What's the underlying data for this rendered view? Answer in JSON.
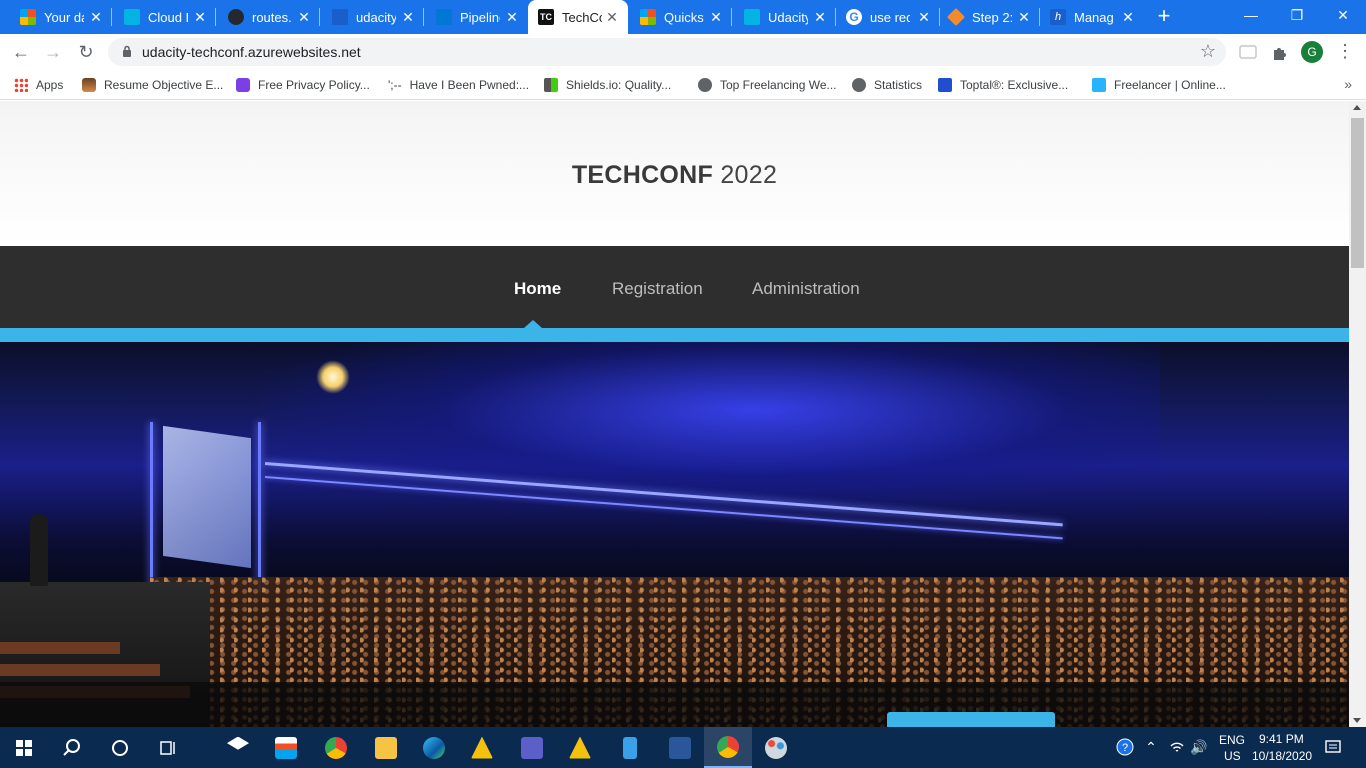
{
  "browser": {
    "tabs": [
      {
        "label": "Your da",
        "active": false
      },
      {
        "label": "Cloud D",
        "active": false
      },
      {
        "label": "routes.p",
        "active": false
      },
      {
        "label": "udacity",
        "active": false
      },
      {
        "label": "Pipeline",
        "active": false
      },
      {
        "label": "TechCo",
        "active": true
      },
      {
        "label": "Quickst",
        "active": false
      },
      {
        "label": "Udacity",
        "active": false
      },
      {
        "label": "use red",
        "active": false
      },
      {
        "label": "Step 2:",
        "active": false
      },
      {
        "label": "Manag",
        "active": false
      }
    ],
    "new_tab_label": "+",
    "url": "udacity-techconf.azurewebsites.net",
    "profile_initial": "G",
    "bookmarks": [
      {
        "label": "Apps"
      },
      {
        "label": "Resume Objective E..."
      },
      {
        "label": "Free Privacy Policy..."
      },
      {
        "label": "Have I Been Pwned:..."
      },
      {
        "label": "Shields.io: Quality..."
      },
      {
        "label": "Top Freelancing We..."
      },
      {
        "label": "Statistics"
      },
      {
        "label": "Toptal®: Exclusive..."
      },
      {
        "label": "Freelancer | Online..."
      }
    ],
    "bookmark_prefix_glyph": "';--",
    "bookmarks_overflow": "»"
  },
  "page": {
    "site_brand": "TECHCONF",
    "site_year": "2022",
    "nav": [
      {
        "label": "Home",
        "active": true
      },
      {
        "label": "Registration",
        "active": false
      },
      {
        "label": "Administration",
        "active": false
      }
    ],
    "hero_image": "conference-auditorium-photo"
  },
  "taskbar": {
    "language": "ENG",
    "region": "US",
    "time": "9:41 PM",
    "date": "10/18/2020"
  },
  "colors": {
    "chrome_blue": "#1a73e8",
    "nav_dark": "#2e2e2e",
    "accent": "#3bb5e8",
    "taskbar": "#0b2a4f"
  }
}
